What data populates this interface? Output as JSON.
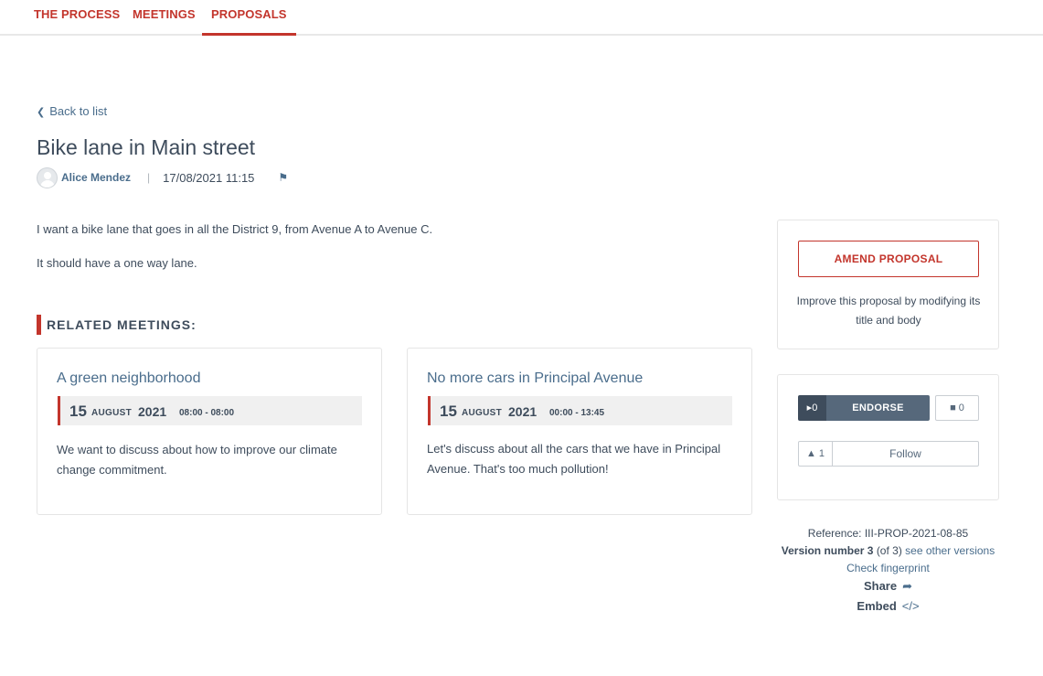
{
  "nav": {
    "items": [
      {
        "label": "THE PROCESS"
      },
      {
        "label": "MEETINGS"
      },
      {
        "label": "PROPOSALS",
        "active": true
      }
    ]
  },
  "back_link": "Back to list",
  "proposal": {
    "title": "Bike lane in Main street",
    "author": "Alice Mendez",
    "date": "17/08/2021 11:15",
    "body": [
      "I want a bike lane that goes in all the District 9, from Avenue A to Avenue C.",
      "It should have a one way lane."
    ]
  },
  "related": {
    "title": "RELATED MEETINGS:",
    "meetings": [
      {
        "title": "A green neighborhood",
        "day": "15",
        "month": "AUGUST",
        "year": "2021",
        "time": "08:00 - 08:00",
        "description": "We want to discuss about how to improve our climate change commitment."
      },
      {
        "title": "No more cars in Principal Avenue",
        "day": "15",
        "month": "AUGUST",
        "year": "2021",
        "time": "00:00 - 13:45",
        "description": "Let's discuss about all the cars that we have in Principal Avenue. That's too much pollution!"
      }
    ]
  },
  "sidebar": {
    "amend_label": "AMEND PROPOSAL",
    "amend_help": "Improve this proposal by modifying its title and body",
    "endorse_count": "0",
    "endorse_label": "ENDORSE",
    "comments_count": "0",
    "followers_count": "1",
    "follow_label": "Follow"
  },
  "meta": {
    "reference": "Reference: III-PROP-2021-08-85",
    "version_label": "Version number 3",
    "version_of": "(of 3)",
    "versions_link": "see other versions",
    "fingerprint_link": "Check fingerprint",
    "share_label": "Share",
    "embed_label": "Embed"
  },
  "colors": {
    "accent": "#c3352c",
    "link": "#4a6d8c",
    "text": "#3e4c5c",
    "endorse_dark": "#3e4c5c",
    "endorse": "#56687b"
  }
}
